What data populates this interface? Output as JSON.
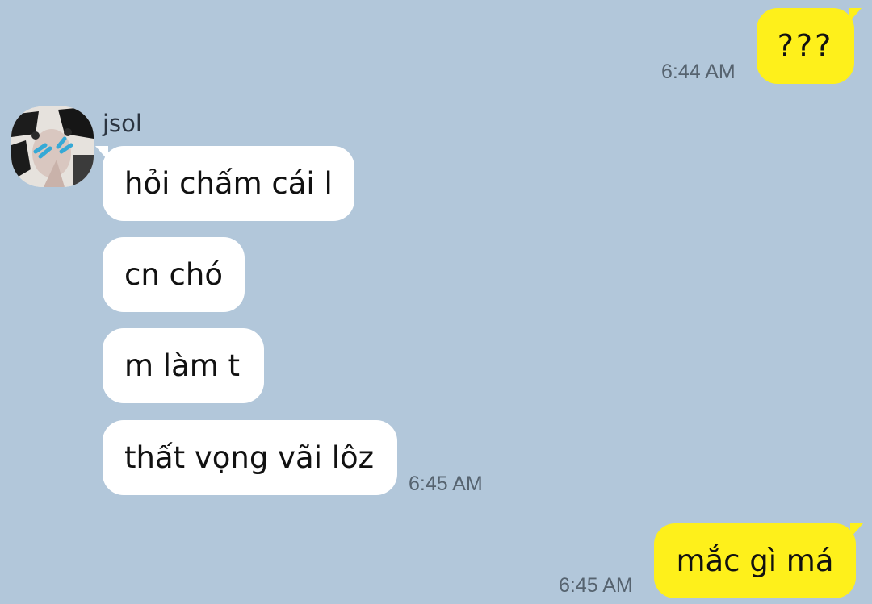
{
  "chat": {
    "outgoing_1": {
      "text": "???",
      "time": "6:44 AM"
    },
    "sender": {
      "name": "jsol",
      "avatar_icon": "cat-avatar-icon"
    },
    "incoming": [
      {
        "text": "hỏi chấm cái l"
      },
      {
        "text": "cn chó"
      },
      {
        "text": "m làm t"
      },
      {
        "text": "thất vọng vãi lôz"
      }
    ],
    "incoming_time": "6:45 AM",
    "outgoing_2": {
      "text": "mắc gì má",
      "time": "6:45 AM"
    }
  },
  "colors": {
    "background": "#b2c7da",
    "outgoing_bubble": "#fef01b",
    "incoming_bubble": "#ffffff",
    "timestamp": "#56636f"
  }
}
